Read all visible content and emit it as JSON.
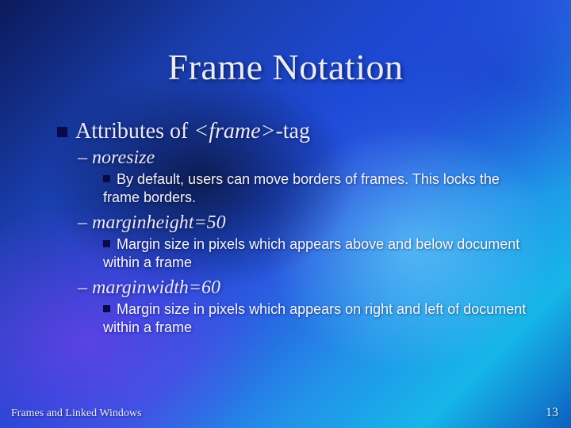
{
  "slide": {
    "title": "Frame Notation",
    "heading_prefix": "Attributes of ",
    "heading_tag": "<frame>",
    "heading_suffix": "-tag",
    "items": [
      {
        "attr": "noresize",
        "desc": "By default, users can move borders of frames. This locks the frame borders."
      },
      {
        "attr": "marginheight=50",
        "desc": "Margin size in pixels which appears above and below document within a frame"
      },
      {
        "attr": "marginwidth=60",
        "desc": "Margin size in pixels which appears on right and left of document within a frame"
      }
    ],
    "footer_left": "Frames and Linked Windows",
    "footer_right": "13"
  }
}
